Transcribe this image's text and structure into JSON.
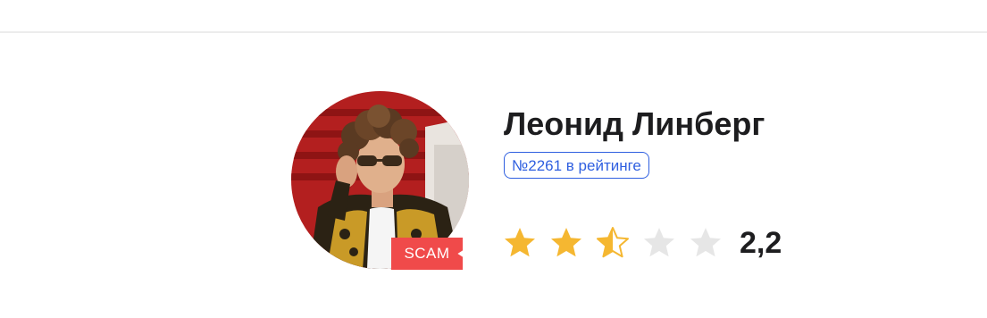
{
  "profile": {
    "name": "Леонид Линберг",
    "rank_label": "№2261 в рейтинге",
    "status_badge": "SCAM",
    "avatar_icon": "person-photo-icon"
  },
  "rating": {
    "value_label": "2,2",
    "value": 2.2,
    "max": 5,
    "stars": [
      {
        "fill": 1.0
      },
      {
        "fill": 1.0
      },
      {
        "fill": 0.5
      },
      {
        "fill": 0.0
      },
      {
        "fill": 0.0
      }
    ]
  },
  "colors": {
    "star_filled": "#f5b731",
    "star_empty": "#e6e6e6",
    "rank_accent": "#2f5fe0",
    "scam_badge": "#f04a4a",
    "text_primary": "#1d1d1f",
    "divider": "#ececec"
  }
}
